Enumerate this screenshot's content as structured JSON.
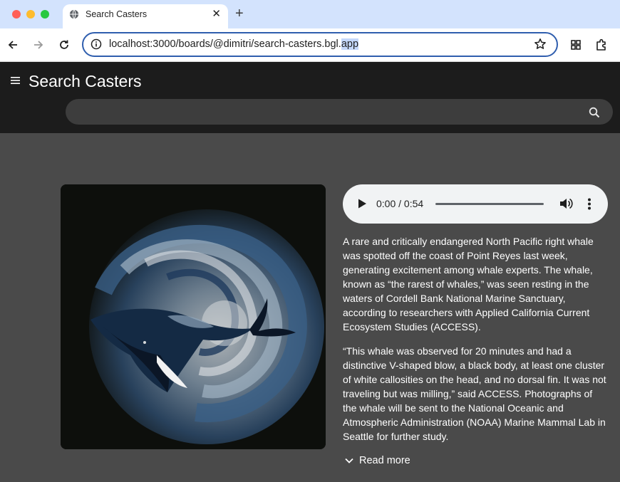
{
  "browser": {
    "tab_title": "Search Casters",
    "url_main": "localhost:3000/boards/@dimitri/search-casters.bgl.",
    "url_selected": "app"
  },
  "header": {
    "title": "Search Casters",
    "search_placeholder": ""
  },
  "player": {
    "time": "0:00 / 0:54",
    "progress": 0
  },
  "article": {
    "paragraph_1": "A rare and critically endangered North Pacific right whale was spotted off the coast of Point Reyes last week, generating excitement among whale experts. The whale, known as “the rarest of whales,” was seen resting in the waters of Cordell Bank National Marine Sanctuary, according to researchers with Applied California Current Ecosystem Studies (ACCESS).",
    "paragraph_2": "“This whale was observed for 20 minutes and had a distinctive V-shaped blow, a black body, at least one cluster of white callosities on the head, and no dorsal fin. It was not traveling but was milling,” said ACCESS. Photographs of the whale will be sent to the National Oceanic and Atmospheric Administration (NOAA) Marine Mammal Lab in Seattle for further study.",
    "read_more": "Read more"
  },
  "colors": {
    "app_background": "#4a4a4a",
    "header_background": "#1c1c1c",
    "tab_strip": "#d3e3fd",
    "omnibox_border": "#2f5eae"
  },
  "icons": [
    "globe-icon",
    "close-icon",
    "plus-icon",
    "back-icon",
    "forward-icon",
    "reload-icon",
    "info-icon",
    "star-icon",
    "apps-icon",
    "extensions-icon",
    "menu-icon",
    "search-icon",
    "play-icon",
    "volume-icon",
    "more-vert-icon",
    "chevron-down-icon"
  ]
}
